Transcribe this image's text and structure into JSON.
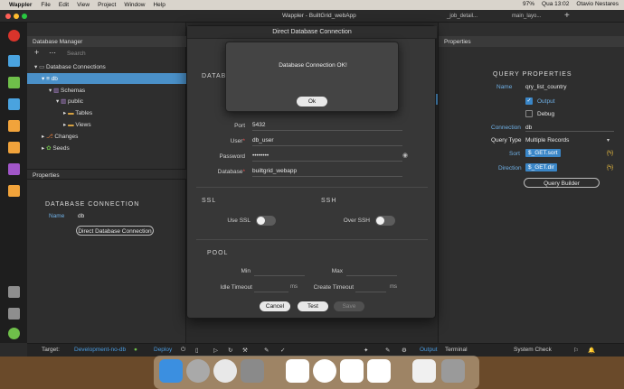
{
  "menubar": {
    "app": "Wappler",
    "items": [
      "File",
      "Edit",
      "View",
      "Project",
      "Window",
      "Help"
    ],
    "battery": "97%",
    "clock": "Qua 13:02",
    "user": "Otavio Nestares"
  },
  "window": {
    "title": "Wappler - BuiltGrid_webApp",
    "tabs": [
      "_job_detail...",
      "main_layo..."
    ]
  },
  "left_panel": {
    "header": "Database Manager",
    "search_placeholder": "Search",
    "tree": {
      "root": "Database Connections",
      "db": "db",
      "schemas": "Schemas",
      "public": "public",
      "tables": "Tables",
      "views": "Views",
      "changes": "Changes",
      "seeds": "Seeds"
    },
    "properties_header": "Properties",
    "section_title": "DATABASE CONNECTION",
    "name_label": "Name",
    "name_value": "db",
    "direct_button": "Direct Database Connection"
  },
  "right_panel": {
    "header": "Properties",
    "section_title": "QUERY PROPERTIES",
    "name_label": "Name",
    "name_value": "qry_list_country",
    "output_label": "Output",
    "debug_label": "Debug",
    "connection_label": "Connection",
    "connection_value": "db",
    "query_type_label": "Query Type",
    "query_type_value": "Multiple Records",
    "sort_label": "Sort",
    "sort_value": "$_GET.sort",
    "direction_label": "Direction",
    "direction_value": "$_GET.dir",
    "query_builder_button": "Query Builder"
  },
  "dialog": {
    "title": "Direct Database Connection",
    "section_database": "DATABA",
    "port_label": "Port",
    "port_value": "5432",
    "user_label": "User",
    "user_value": "db_user",
    "password_label": "Password",
    "password_value": "••••••••",
    "database_label": "Database",
    "database_value": "builtgrid_webapp",
    "ssl_section": "SSL",
    "ssh_section": "SSH",
    "use_ssl_label": "Use SSL",
    "over_ssh_label": "Over SSH",
    "pool_section": "POOL",
    "min_label": "Min",
    "max_label": "Max",
    "idle_timeout_label": "Idle Timeout",
    "create_timeout_label": "Create Timeout",
    "ms_unit": "ms",
    "cancel_button": "Cancel",
    "test_button": "Test",
    "save_button": "Save"
  },
  "alert": {
    "message": "Database Connection OK!",
    "ok_button": "Ok"
  },
  "statusbar": {
    "target_label": "Target:",
    "target_value": "Development-no-db",
    "deploy_label": "Deploy",
    "output_label": "Output",
    "terminal_label": "Terminal",
    "system_check_label": "System Check"
  },
  "colors": {
    "accent": "#4a90c8",
    "token": "#3a86c7",
    "label_blue": "#6fb0e6",
    "required": "#e84a4a"
  }
}
